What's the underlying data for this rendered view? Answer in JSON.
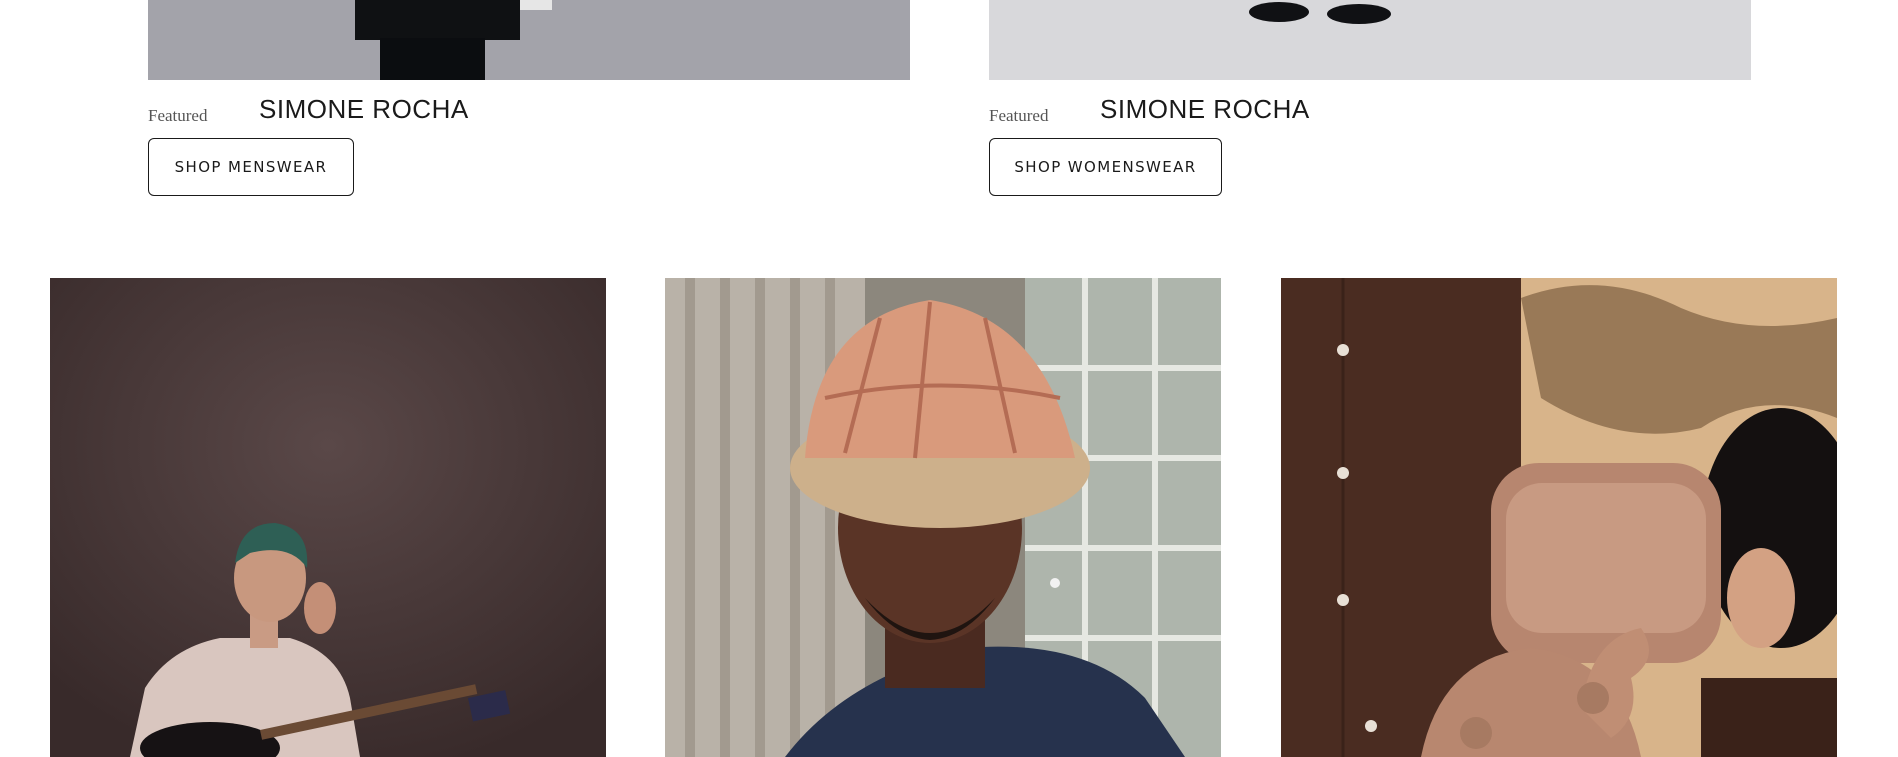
{
  "features": [
    {
      "featured_label": "Featured",
      "brand": "SIMONE ROCHA",
      "button_label": "SHOP MENSWEAR"
    },
    {
      "featured_label": "Featured",
      "brand": "SIMONE ROCHA",
      "button_label": "SHOP WOMENSWEAR"
    }
  ],
  "colors": {
    "text": "#1a1a1a",
    "tile1_bg": "#4a3a39",
    "tile2_bg": "#8f8a80",
    "tile3_bg": "#4a2e22"
  }
}
